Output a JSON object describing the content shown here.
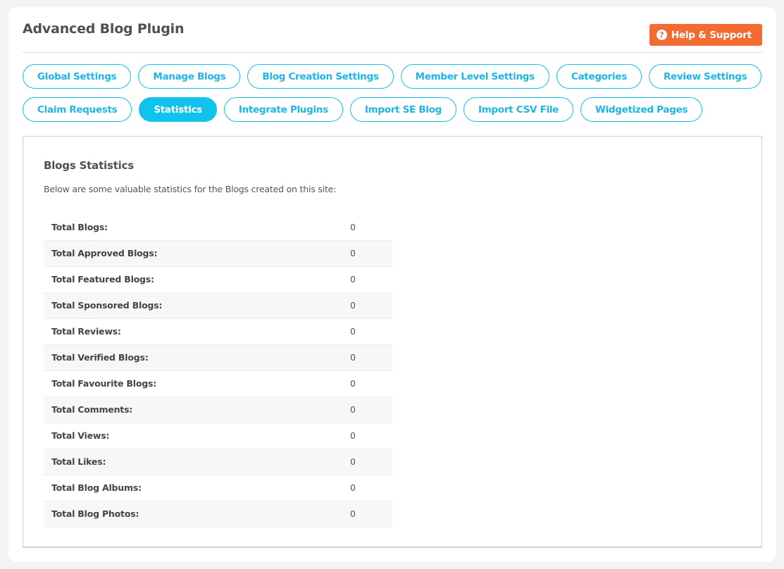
{
  "header": {
    "title": "Advanced Blog Plugin",
    "help_button": {
      "label": "Help & Support",
      "icon": "question-circle-icon",
      "icon_glyph": "?",
      "color": "#f46b31"
    }
  },
  "tabs": [
    {
      "label": "Global Settings",
      "active": false
    },
    {
      "label": "Manage Blogs",
      "active": false
    },
    {
      "label": "Blog Creation Settings",
      "active": false
    },
    {
      "label": "Member Level Settings",
      "active": false
    },
    {
      "label": "Categories",
      "active": false
    },
    {
      "label": "Review Settings",
      "active": false
    },
    {
      "label": "Claim Requests",
      "active": false
    },
    {
      "label": "Statistics",
      "active": true
    },
    {
      "label": "Integrate Plugins",
      "active": false
    },
    {
      "label": "Import SE Blog",
      "active": false
    },
    {
      "label": "Import CSV File",
      "active": false
    },
    {
      "label": "Widgetized Pages",
      "active": false
    }
  ],
  "accent_color": "#10c3ec",
  "panel": {
    "title": "Blogs Statistics",
    "description": "Below are some valuable statistics for the Blogs created on this site:",
    "stats": [
      {
        "label": "Total Blogs:",
        "value": "0"
      },
      {
        "label": "Total Approved Blogs:",
        "value": "0"
      },
      {
        "label": "Total Featured Blogs:",
        "value": "0"
      },
      {
        "label": "Total Sponsored Blogs:",
        "value": "0"
      },
      {
        "label": "Total Reviews:",
        "value": "0"
      },
      {
        "label": "Total Verified Blogs:",
        "value": "0"
      },
      {
        "label": "Total Favourite Blogs:",
        "value": "0"
      },
      {
        "label": "Total Comments:",
        "value": "0"
      },
      {
        "label": "Total Views:",
        "value": "0"
      },
      {
        "label": "Total Likes:",
        "value": "0"
      },
      {
        "label": "Total Blog Albums:",
        "value": "0"
      },
      {
        "label": "Total Blog Photos:",
        "value": "0"
      }
    ]
  }
}
